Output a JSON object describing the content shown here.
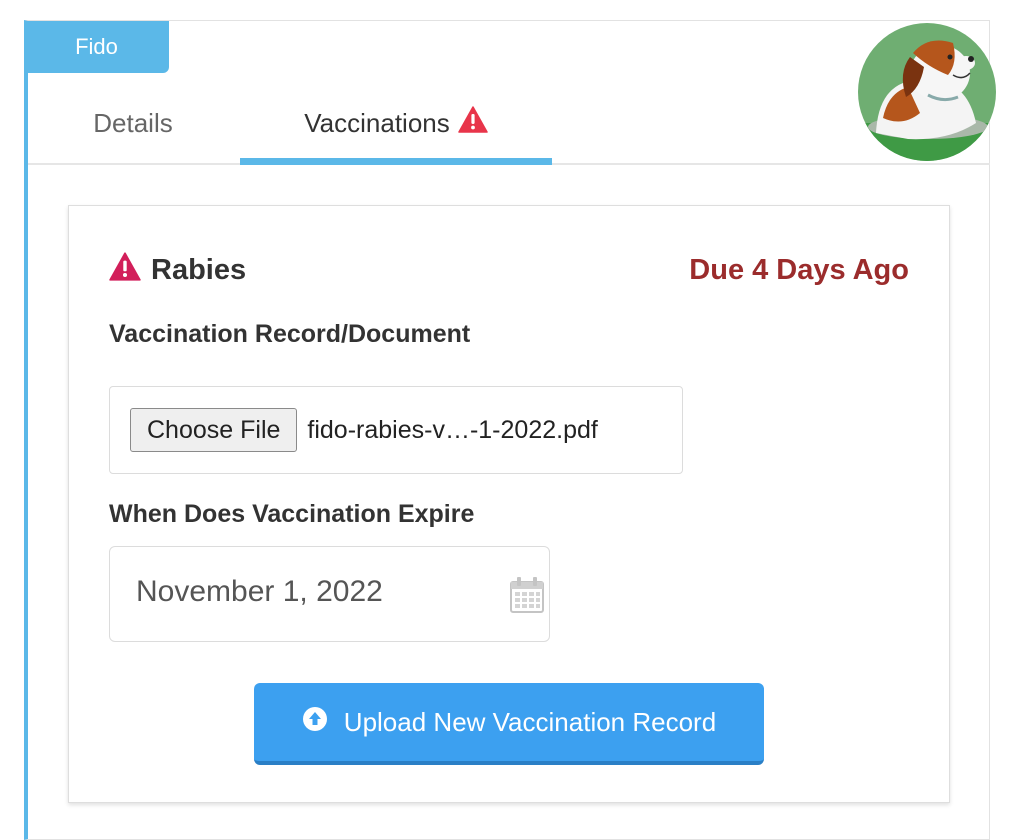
{
  "pet": {
    "name": "Fido"
  },
  "tabs": [
    {
      "label": "Details",
      "active": false
    },
    {
      "label": "Vaccinations",
      "active": true,
      "warning": true
    }
  ],
  "vaccination": {
    "name": "Rabies",
    "status": "Due 4 Days Ago",
    "record_label": "Vaccination Record/Document",
    "choose_file_label": "Choose File",
    "file_name": "fido-rabies-v…-1-2022.pdf",
    "expire_label": "When Does Vaccination Expire",
    "expire_date": "November 1, 2022",
    "upload_label": "Upload New Vaccination Record"
  },
  "colors": {
    "accent": "#5bb8e8",
    "warning": "#e8354a",
    "overdue": "#9b2c2c",
    "button": "#3ca0f0"
  },
  "icons": [
    "warning-icon",
    "calendar-icon",
    "upload-circle-icon",
    "dog-avatar"
  ]
}
